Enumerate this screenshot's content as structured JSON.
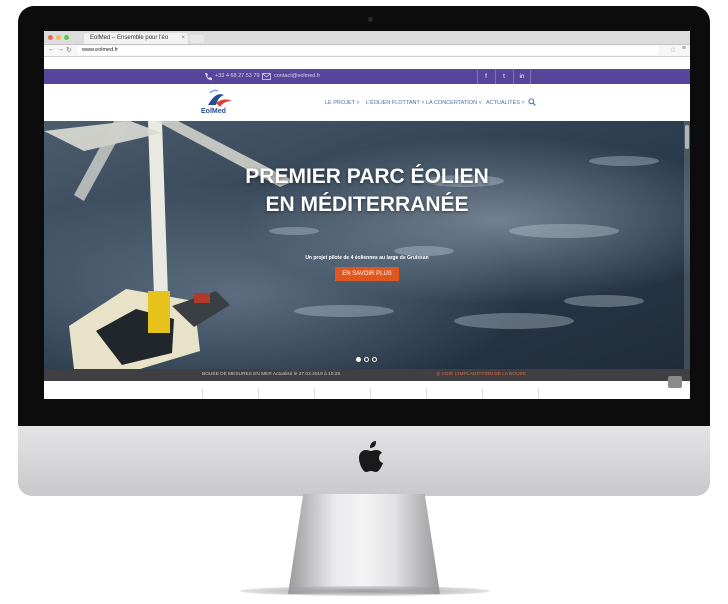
{
  "browser": {
    "tab_title": "EolMed – Ensemble pour l'éo",
    "url": "www.eolmed.fr"
  },
  "topbar": {
    "phone": "+33 4 68 27 53 79",
    "email": "contact@eolmed.fr",
    "social": [
      "f",
      "t",
      "in"
    ]
  },
  "header": {
    "logo_text": "EolMed",
    "nav": [
      "LE PROJET ˅",
      "L'ÉOLIEN FLOTTANT ˅",
      "LA CONCERTATION ˅",
      "ACTUALITÉS ˅"
    ]
  },
  "hero": {
    "title_line1": "PREMIER PARC ÉOLIEN",
    "title_line2": "EN MÉDITERRANÉE",
    "subtitle": "Un projet pilote de 4 éoliennes au large de Gruissan",
    "button": "EN SAVOIR PLUS",
    "slides": 3,
    "active_slide": 1
  },
  "buoy_bar": {
    "left": "BOUÉE DE MESURES EN MER Actualisé le 27.03.2019 à 10:25",
    "right": "◎ VOIR L'IMPLANTATION DE LA BOUÉE"
  },
  "colors": {
    "purple": "#56459a",
    "orange": "#e0561f",
    "nav_blue": "#4a6dad"
  }
}
